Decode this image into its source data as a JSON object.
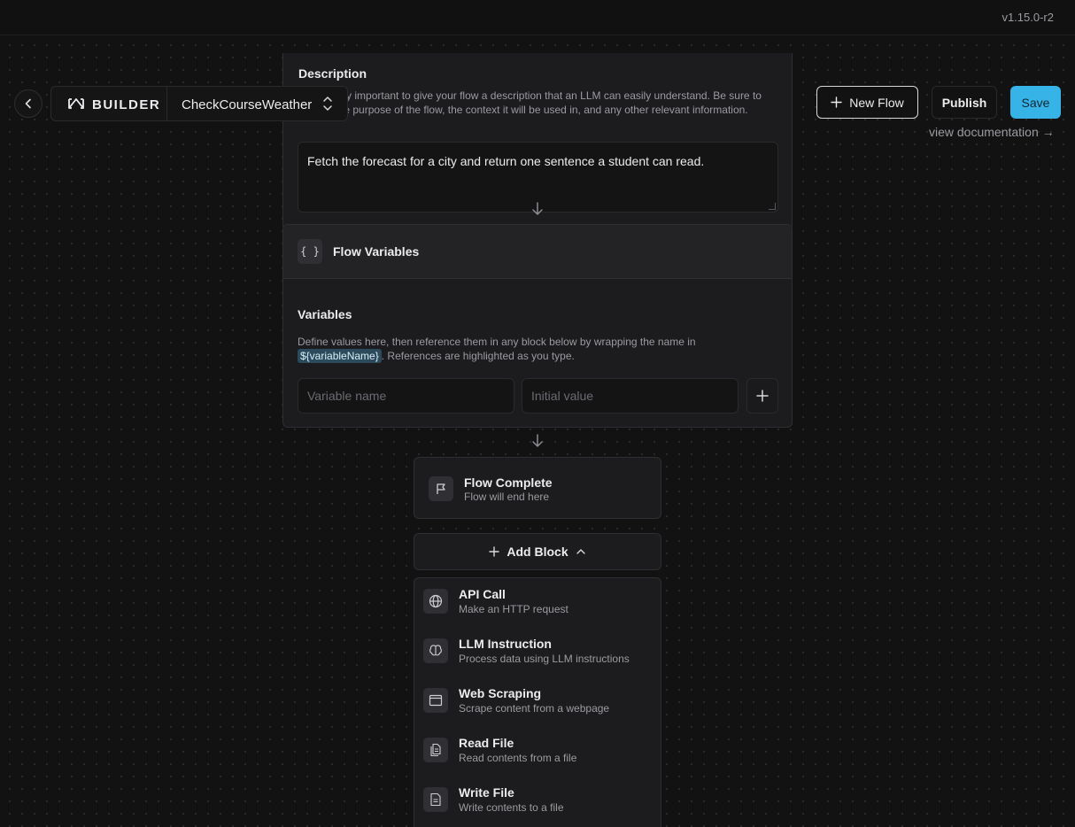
{
  "app": {
    "version": "v1.15.0-r2"
  },
  "header": {
    "builder_label": "BUILDER",
    "flow_name": "CheckCourseWeather",
    "new_flow_label": "New Flow",
    "publish_label": "Publish",
    "save_label": "Save",
    "docs_link": "view documentation →"
  },
  "description": {
    "title": "Description",
    "help": "It is equally important to give your flow a description that an LLM can easily understand. Be sure to include the purpose of the flow, the context it will be used in, and any other relevant information.",
    "value": "Fetch the forecast for a city and return one sentence a student can read."
  },
  "variables": {
    "block_title": "Flow Variables",
    "section_title": "Variables",
    "help_before": "Define values here, then reference them in any block below by wrapping the name in ",
    "help_chip": "${variableName}",
    "help_after": ". References are highlighted as you type.",
    "name_placeholder": "Variable name",
    "value_placeholder": "Initial value"
  },
  "complete": {
    "title": "Flow Complete",
    "subtitle": "Flow will end here"
  },
  "add_block": {
    "label": "Add Block",
    "items": [
      {
        "title": "API Call",
        "subtitle": "Make an HTTP request",
        "icon": "globe-icon"
      },
      {
        "title": "LLM Instruction",
        "subtitle": "Process data using LLM instructions",
        "icon": "brain-icon"
      },
      {
        "title": "Web Scraping",
        "subtitle": "Scrape content from a webpage",
        "icon": "browser-window-icon"
      },
      {
        "title": "Read File",
        "subtitle": "Read contents from a file",
        "icon": "files-icon"
      },
      {
        "title": "Write File",
        "subtitle": "Write contents to a file",
        "icon": "file-text-icon"
      }
    ]
  }
}
